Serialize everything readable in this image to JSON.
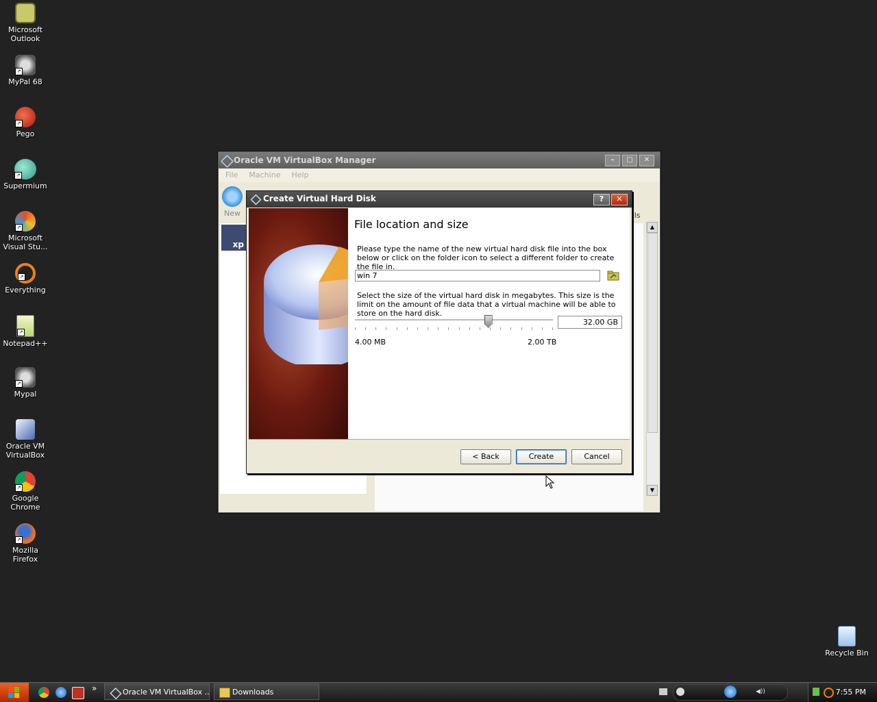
{
  "desktop": {
    "icons": [
      {
        "label": "Microsoft Outlook",
        "icon": "outlook-icon"
      },
      {
        "label": "MyPal 68",
        "icon": "mypal-icon"
      },
      {
        "label": "Pego",
        "icon": "pego-icon"
      },
      {
        "label": "Supermium",
        "icon": "supermium-icon"
      },
      {
        "label": "Microsoft Visual Stu...",
        "icon": "visual-studio-icon"
      },
      {
        "label": "Everything",
        "icon": "everything-icon"
      },
      {
        "label": "Notepad++",
        "icon": "notepadpp-icon"
      },
      {
        "label": "Mypal",
        "icon": "mypal-icon"
      },
      {
        "label": "Oracle VM VirtualBox",
        "icon": "virtualbox-icon"
      },
      {
        "label": "Google Chrome",
        "icon": "chrome-icon"
      },
      {
        "label": "Mozilla Firefox",
        "icon": "firefox-icon"
      }
    ],
    "recycle_bin": "Recycle Bin"
  },
  "vbox_manager": {
    "title": "Oracle VM VirtualBox Manager",
    "menu": [
      "File",
      "Machine",
      "Help"
    ],
    "toolbar_new": "New",
    "tools_partial": "ols",
    "vm_tile_label": "xp"
  },
  "dialog": {
    "title": "Create Virtual Hard Disk",
    "help_btn": "?",
    "close_btn": "✕",
    "heading": "File location and size",
    "description_location": "Please type the name of the new virtual hard disk file into the box below or click on the folder icon to select a different folder to create the file in.",
    "file_name": "win 7",
    "description_size": "Select the size of the virtual hard disk in megabytes. This size is the limit on the amount of file data that a virtual machine will be able to store on the hard disk.",
    "slider_min_label": "4.00 MB",
    "slider_max_label": "2.00 TB",
    "size_value": "32.00 GB",
    "slider_fraction": 0.67,
    "buttons": {
      "back": "< Back",
      "create": "Create",
      "cancel": "Cancel"
    }
  },
  "taskbar": {
    "tasks": [
      {
        "label": "Oracle VM VirtualBox ...",
        "icon": "virtualbox-icon"
      },
      {
        "label": "Downloads",
        "icon": "folder-icon"
      }
    ],
    "overflow": "»",
    "clock": "7:55 PM"
  },
  "colors": {
    "desktop_bg": "#222222",
    "dialog_title": "#3a3a3a",
    "banner": "#6b1a10",
    "start_button": "#e05010"
  }
}
